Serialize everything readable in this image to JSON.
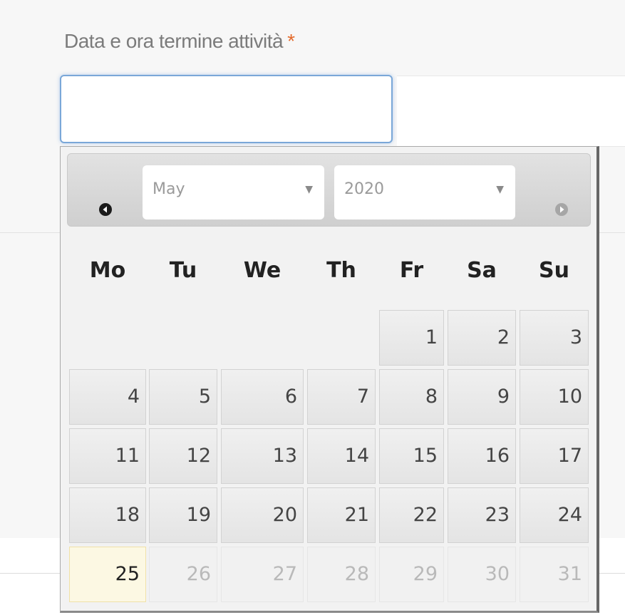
{
  "field": {
    "label": "Data e ora termine attività",
    "required_mark": "*",
    "value": ""
  },
  "datepicker": {
    "month_selected": "May",
    "year_selected": "2020",
    "prev_icon": "prev-month-icon",
    "next_icon": "next-month-icon",
    "weekdays": [
      "Mo",
      "Tu",
      "We",
      "Th",
      "Fr",
      "Sa",
      "Su"
    ],
    "weeks": [
      [
        "",
        "",
        "",
        "",
        "1",
        "2",
        "3"
      ],
      [
        "4",
        "5",
        "6",
        "7",
        "8",
        "9",
        "10"
      ],
      [
        "11",
        "12",
        "13",
        "14",
        "15",
        "16",
        "17"
      ],
      [
        "18",
        "19",
        "20",
        "21",
        "22",
        "23",
        "24"
      ],
      [
        "25",
        "26",
        "27",
        "28",
        "29",
        "30",
        "31"
      ]
    ],
    "today": "25",
    "disabled_days": [
      "26",
      "27",
      "28",
      "29",
      "30",
      "31"
    ]
  },
  "colors": {
    "required": "#e46a2b",
    "focus_border": "#7aa7d8",
    "today_highlight": "#fcf8e3"
  }
}
